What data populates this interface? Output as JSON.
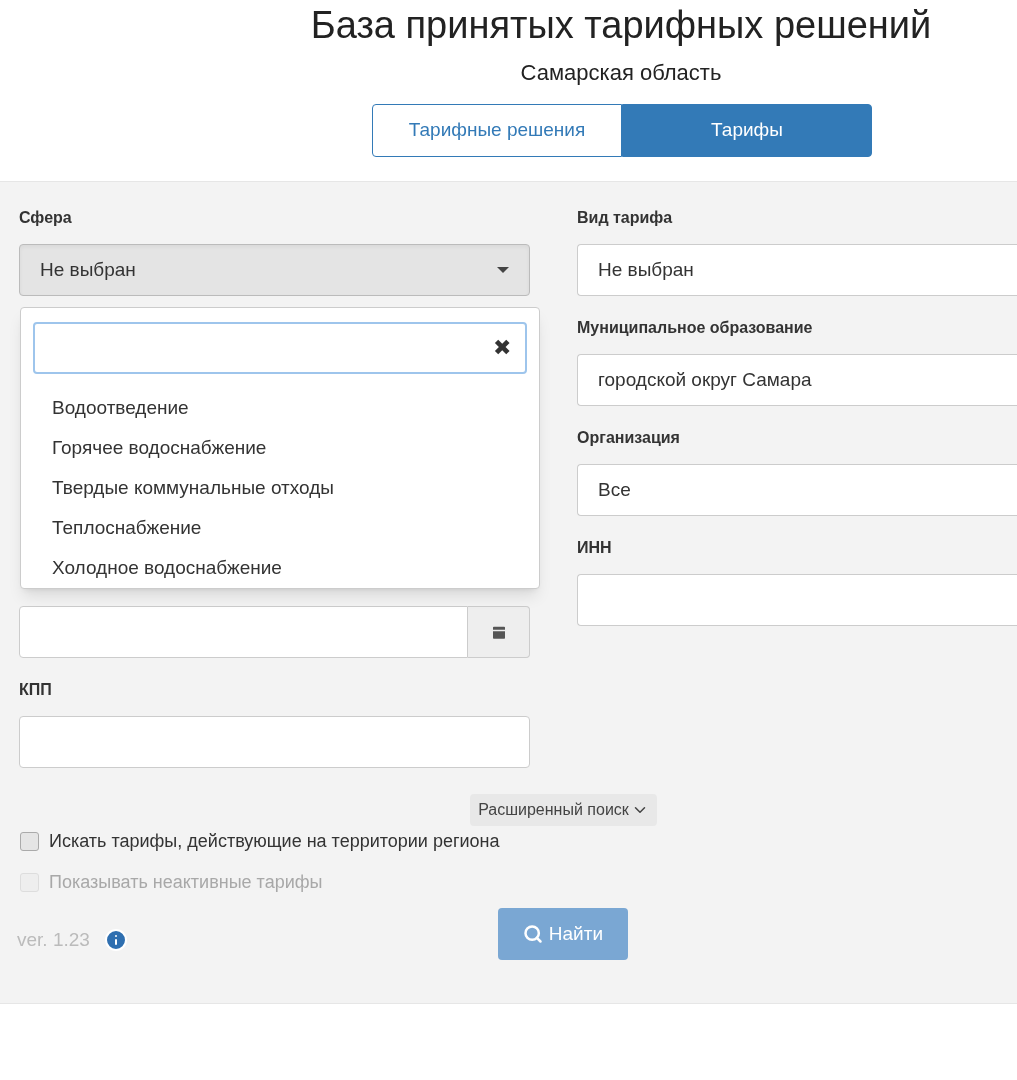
{
  "title": "База принятых тарифных решений",
  "subtitle": "Самарская область",
  "tabs": [
    {
      "label": "Тарифные решения",
      "selected": false
    },
    {
      "label": "Тарифы",
      "selected": true
    }
  ],
  "left_fields": [
    {
      "label": "Сфера",
      "kind": "select",
      "value": "Не выбран"
    },
    {
      "kind": "date"
    },
    {
      "label": "КПП",
      "kind": "text"
    }
  ],
  "right_fields": [
    {
      "label": "Вид тарифа",
      "value": "Не выбран"
    },
    {
      "label": "Муниципальное образование",
      "value": "городской округ Самара"
    },
    {
      "label": "Организация",
      "value": "Все"
    },
    {
      "label": "ИНН"
    }
  ],
  "dropdown": {
    "clear": "✖",
    "options": [
      "Водоотведение",
      "Горячее водоснабжение",
      "Твердые коммунальные отходы",
      "Теплоснабжение",
      "Холодное водоснабжение"
    ]
  },
  "advanced_search": "Расширенный поиск",
  "checkboxes": [
    {
      "label": "Искать тарифы, действующие на территории региона",
      "checked": false,
      "disabled": false
    },
    {
      "label": "Показывать неактивные тарифы",
      "checked": false,
      "disabled": true
    }
  ],
  "version": "ver. 1.23",
  "search_button": {
    "label": "Найти",
    "disabled": true
  }
}
